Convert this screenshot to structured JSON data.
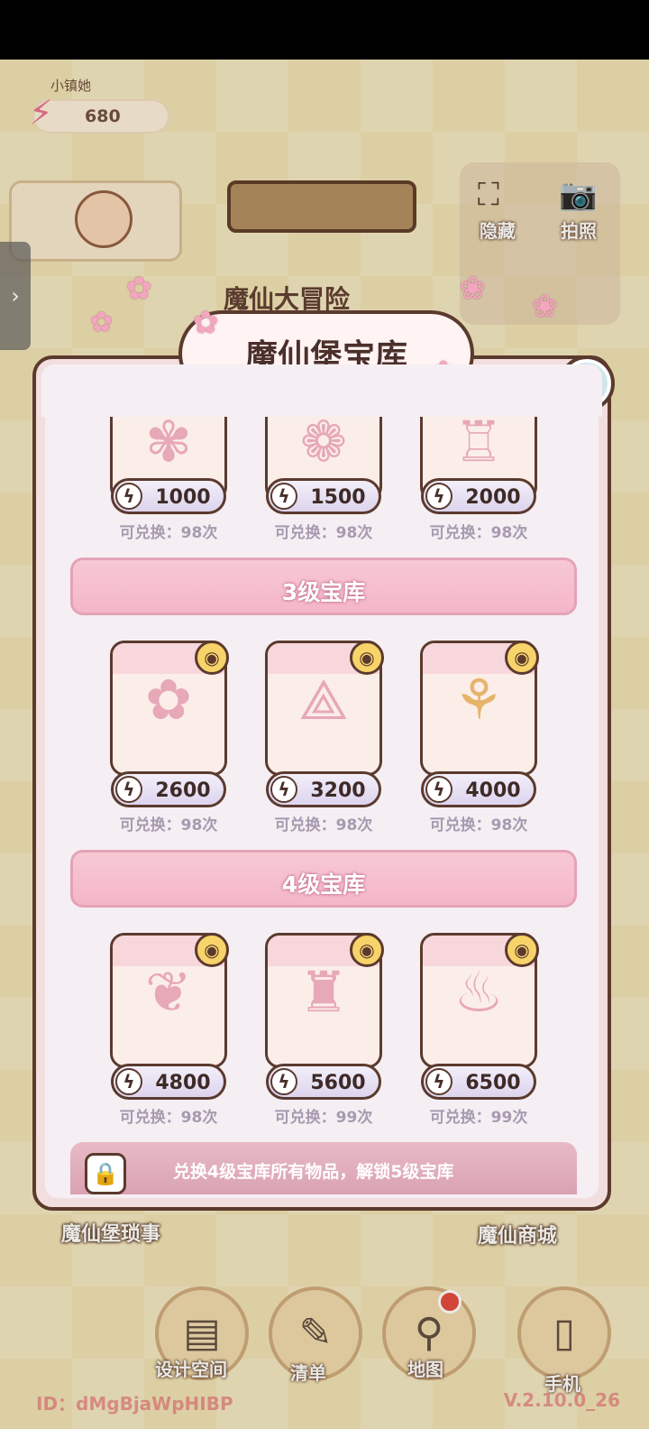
{
  "energy": {
    "value": "680"
  },
  "background": {
    "avatar_label": "小镇她",
    "behind_title": "魔仙大冒险",
    "tools": {
      "hide_label": "隐藏",
      "photo_label": "拍照"
    },
    "left_label": "魔仙堡琐事",
    "right_label": "魔仙商城",
    "nav": [
      {
        "label": "设计空间",
        "icon": "design-icon"
      },
      {
        "label": "清单",
        "icon": "list-icon"
      },
      {
        "label": "地图",
        "icon": "map-pin-icon"
      },
      {
        "label": "手机",
        "icon": "phone-icon"
      }
    ],
    "footer_id": "ID：dMgBjaWpHIBP",
    "footer_version": "V.2.10.0_26"
  },
  "modal": {
    "title": "魔仙堡宝库",
    "tier2_items": [
      {
        "price": "1000",
        "count": "可兑换：98次"
      },
      {
        "price": "1500",
        "count": "可兑换：98次"
      },
      {
        "price": "2000",
        "count": "可兑换：98次"
      }
    ],
    "tier3": {
      "label": "3级宝库",
      "items": [
        {
          "price": "2600",
          "count": "可兑换：98次"
        },
        {
          "price": "3200",
          "count": "可兑换：98次"
        },
        {
          "price": "4000",
          "count": "可兑换：98次"
        }
      ]
    },
    "tier4": {
      "label": "4级宝库",
      "items": [
        {
          "price": "4800",
          "count": "可兑换：98次"
        },
        {
          "price": "5600",
          "count": "可兑换：99次"
        },
        {
          "price": "6500",
          "count": "可兑换：99次"
        }
      ]
    },
    "unlock_text": "兑换4级宝库所有物品，解锁5级宝库"
  },
  "colors": {
    "accent_pink": "#f4b6c8",
    "outline": "#5b3a2e",
    "energy": "#e86a8e"
  }
}
